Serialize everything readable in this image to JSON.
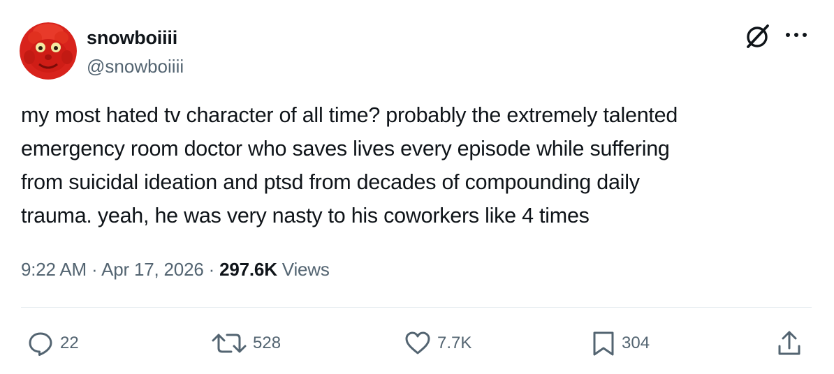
{
  "author": {
    "display_name": "snowboiiii",
    "handle": "@snowboiiii"
  },
  "tweet": {
    "text": "my most hated tv character of all time? probably the extremely talented\nemergency room doctor who saves lives every episode while suffering\nfrom suicidal ideation and ptsd from decades of compounding daily\ntrauma. yeah, he was very nasty to his coworkers like 4 times"
  },
  "meta": {
    "time": "9:22 AM",
    "separator": "·",
    "date": "Apr 17, 2026",
    "views_count": "297.6K",
    "views_label": "Views"
  },
  "actions": {
    "replies": "22",
    "reposts": "528",
    "likes": "7.7K",
    "bookmarks": "304"
  },
  "icons": {
    "top_right": [
      "grok-icon",
      "more-icon"
    ],
    "action_bar": [
      "reply-icon",
      "retweet-icon",
      "like-icon",
      "bookmark-icon",
      "share-icon"
    ]
  },
  "colors": {
    "text": "#0f1419",
    "secondary_text": "#536471",
    "divider": "#e6ecf0",
    "avatar_red": "#d8231c"
  }
}
